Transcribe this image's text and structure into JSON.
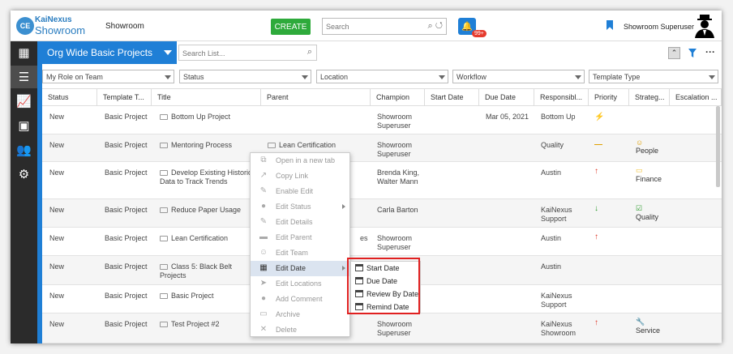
{
  "header": {
    "logo_mark": "CE",
    "logo_top": "KaiNexus",
    "logo_bottom": "Showroom",
    "org_name": "Showroom",
    "create_label": "CREATE",
    "search_placeholder": "Search",
    "notification_count": "99+",
    "user_name": "Showroom Superuser",
    "accent_color": "#1f7fd6",
    "create_color": "#2eaa3b"
  },
  "nav": {
    "icons": [
      "grid-icon",
      "list-icon",
      "chart-icon",
      "calendar-icon",
      "people-icon",
      "gear-icon"
    ]
  },
  "list": {
    "title": "Org Wide Basic Projects",
    "search_placeholder": "Search List..."
  },
  "filters": [
    "My Role on Team",
    "Status",
    "Location",
    "Workflow",
    "Template Type"
  ],
  "columns": [
    "Status",
    "Template T...",
    "Title",
    "Parent",
    "Champion",
    "Start Date",
    "Due Date",
    "Responsibl...",
    "Priority",
    "Strateg...",
    "Escalation ..."
  ],
  "rows": [
    {
      "status": "New",
      "template": "Basic Project",
      "title": "Bottom Up Project",
      "parent": "",
      "champion": "Showroom Superuser",
      "start": "",
      "due": "Mar 05, 2021",
      "responsible": "Bottom Up",
      "priority": "⚡",
      "strategy": ""
    },
    {
      "status": "New",
      "template": "Basic Project",
      "title": "Mentoring Process",
      "parent": "Lean Certification",
      "champion": "Showroom Superuser",
      "start": "",
      "due": "",
      "responsible": "Quality",
      "priority": "—",
      "strategy": "People"
    },
    {
      "status": "New",
      "template": "Basic Project",
      "title": "Develop Existing Historical Data to Track Trends",
      "parent": "",
      "champion": "Brenda King, Walter Mann",
      "start": "",
      "due": "",
      "responsible": "Austin",
      "priority": "↑",
      "strategy": "Finance"
    },
    {
      "status": "New",
      "template": "Basic Project",
      "title": "Reduce Paper Usage",
      "parent": "",
      "champion": "Carla Barton",
      "start": "",
      "due": "",
      "responsible": "KaiNexus Support",
      "priority": "↓",
      "strategy": "Quality"
    },
    {
      "status": "New",
      "template": "Basic Project",
      "title": "Lean Certification",
      "parent": "es",
      "champion": "Showroom Superuser",
      "start": "",
      "due": "",
      "responsible": "Austin",
      "priority": "↑",
      "strategy": ""
    },
    {
      "status": "New",
      "template": "Basic Project",
      "title": "Class 5: Black Belt Projects",
      "parent": "",
      "champion": "",
      "start": "",
      "due": "",
      "responsible": "Austin",
      "priority": "",
      "strategy": ""
    },
    {
      "status": "New",
      "template": "Basic Project",
      "title": "Basic Project",
      "parent": "",
      "champion": "",
      "start": "",
      "due": "",
      "responsible": "KaiNexus Support",
      "priority": "",
      "strategy": ""
    },
    {
      "status": "New",
      "template": "Basic Project",
      "title": "Test Project #2",
      "parent": "",
      "champion": "Showroom Superuser",
      "start": "",
      "due": "",
      "responsible": "KaiNexus Showroom",
      "priority": "↑",
      "strategy": "Service"
    }
  ],
  "context_menu": [
    {
      "label": "Open in a new tab",
      "icon": "external-link-icon",
      "glyph": "⧉"
    },
    {
      "label": "Copy Link",
      "icon": "copy-link-icon",
      "glyph": "↗"
    },
    {
      "label": "Enable Edit",
      "icon": "pencil-icon",
      "glyph": "✎"
    },
    {
      "label": "Edit Status",
      "icon": "circle-icon",
      "glyph": "●"
    },
    {
      "label": "Edit Details",
      "icon": "pencil-icon",
      "glyph": "✎"
    },
    {
      "label": "Edit Parent",
      "icon": "folder-icon",
      "glyph": "▬"
    },
    {
      "label": "Edit Team",
      "icon": "team-icon",
      "glyph": "☺"
    },
    {
      "label": "Edit Date",
      "icon": "calendar-icon",
      "glyph": "▦"
    },
    {
      "label": "Edit Locations",
      "icon": "location-arrow-icon",
      "glyph": "➤"
    },
    {
      "label": "Add Comment",
      "icon": "comment-icon",
      "glyph": "●"
    },
    {
      "label": "Archive",
      "icon": "archive-icon",
      "glyph": "▭"
    },
    {
      "label": "Delete",
      "icon": "delete-icon",
      "glyph": "✕"
    }
  ],
  "submenu": [
    "Start Date",
    "Due Date",
    "Review By Date",
    "Remind Date"
  ]
}
